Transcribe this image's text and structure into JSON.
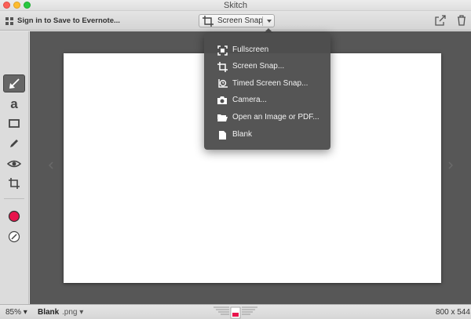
{
  "window": {
    "title": "Skitch"
  },
  "toolbar": {
    "signin_label": "Sign in to Save to Evernote...",
    "snap_label": "Screen Snap"
  },
  "menu": {
    "items": [
      {
        "label": "Fullscreen",
        "icon": "fullscreen-icon"
      },
      {
        "label": "Screen Snap...",
        "icon": "crop-icon"
      },
      {
        "label": "Timed Screen Snap...",
        "icon": "timer-crop-icon"
      },
      {
        "label": "Camera...",
        "icon": "camera-icon"
      },
      {
        "label": "Open an Image or PDF...",
        "icon": "folder-icon"
      },
      {
        "label": "Blank",
        "icon": "document-icon"
      }
    ]
  },
  "tools": {
    "items": [
      "arrow-icon",
      "text-icon",
      "rectangle-icon",
      "pen-icon",
      "blur-icon",
      "crop-icon",
      "color-icon",
      "stroke-icon"
    ],
    "active": "arrow-icon",
    "current_color": "#e8144c"
  },
  "status": {
    "zoom": "85%",
    "filename": "Blank",
    "extension": ".png",
    "dimensions": "800 x 544"
  },
  "colors": {
    "canvas_bg": "#575757",
    "menu_bg": "#4e4e4e",
    "accent_red": "#e8144c"
  }
}
